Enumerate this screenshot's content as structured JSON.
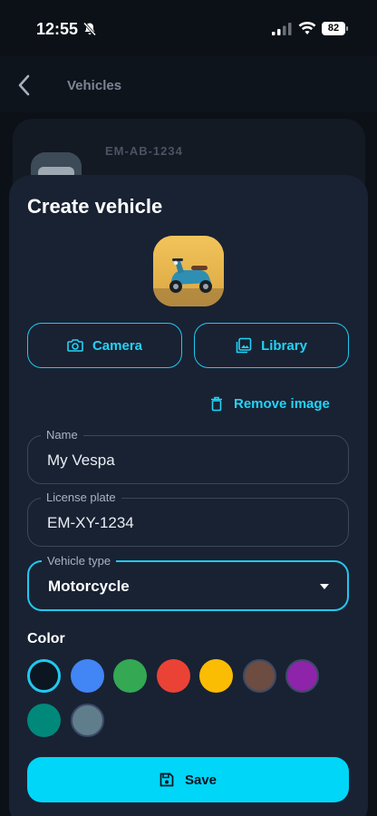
{
  "status_bar": {
    "time": "12:55",
    "battery": "82"
  },
  "header": {
    "title": "Vehicles"
  },
  "background_list": {
    "plate": "EM-AB-1234"
  },
  "sheet": {
    "title": "Create vehicle",
    "camera_label": "Camera",
    "library_label": "Library",
    "remove_label": "Remove image",
    "name": {
      "label": "Name",
      "value": "My Vespa"
    },
    "plate": {
      "label": "License plate",
      "value": "EM-XY-1234"
    },
    "type": {
      "label": "Vehicle type",
      "value": "Motorcycle"
    },
    "color_label": "Color",
    "colors": [
      "#0c1620",
      "#4285f4",
      "#34a853",
      "#ea4335",
      "#fbbc04",
      "#6d4c41",
      "#8e24aa",
      "#00897b",
      "#607d8b"
    ],
    "selected_color_index": 0,
    "save_label": "Save"
  },
  "icons": [
    "bell-off-icon",
    "signal-icon",
    "wifi-icon",
    "back-chevron-icon",
    "camera-icon",
    "image-icon",
    "trash-icon",
    "dropdown-arrow-icon",
    "save-icon"
  ]
}
